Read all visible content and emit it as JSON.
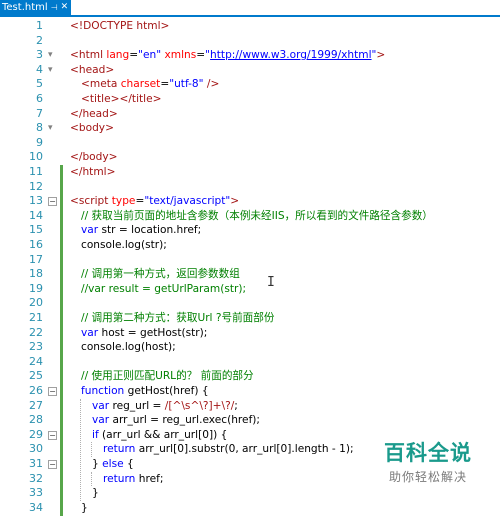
{
  "tab": {
    "title": "Test.html",
    "pin_glyph": "⊣",
    "close_glyph": "✕"
  },
  "watermark": {
    "title": "百科全说",
    "subtitle": "助你轻松解决"
  },
  "colors": {
    "keyword": "#0000ff",
    "tag": "#a31515",
    "attribute": "#ff0000",
    "comment": "#008000",
    "regex": "#a31515",
    "line_number": "#2b91af",
    "change_bar": "#57a64a",
    "tab": "#007acc"
  },
  "lines": [
    {
      "n": "1",
      "indent": 0,
      "tokens": [
        [
          "t",
          "<!DOCTYPE html>"
        ]
      ]
    },
    {
      "n": "2",
      "indent": 0,
      "tokens": []
    },
    {
      "n": "3",
      "indent": 0,
      "fold": "open",
      "tokens": [
        [
          "t",
          "<html "
        ],
        [
          "a",
          "lang"
        ],
        [
          "p",
          "="
        ],
        [
          "s",
          "\"en\""
        ],
        [
          "p",
          " "
        ],
        [
          "a",
          "xmlns"
        ],
        [
          "p",
          "="
        ],
        [
          "s",
          "\""
        ],
        [
          "u",
          "http://www.w3.org/1999/xhtml"
        ],
        [
          "s",
          "\""
        ],
        [
          "t",
          ">"
        ]
      ]
    },
    {
      "n": "4",
      "indent": 0,
      "fold": "open",
      "tokens": [
        [
          "t",
          "<head>"
        ]
      ]
    },
    {
      "n": "5",
      "indent": 1,
      "tokens": [
        [
          "t",
          "<meta "
        ],
        [
          "a",
          "charset"
        ],
        [
          "p",
          "="
        ],
        [
          "s",
          "\"utf-8\""
        ],
        [
          "t",
          " />"
        ]
      ]
    },
    {
      "n": "6",
      "indent": 1,
      "tokens": [
        [
          "t",
          "<title></title>"
        ]
      ]
    },
    {
      "n": "7",
      "indent": 0,
      "tokens": [
        [
          "t",
          "</head>"
        ]
      ]
    },
    {
      "n": "8",
      "indent": 0,
      "fold": "open",
      "tokens": [
        [
          "t",
          "<body>"
        ]
      ]
    },
    {
      "n": "9",
      "indent": 0,
      "tokens": []
    },
    {
      "n": "10",
      "indent": 0,
      "tokens": [
        [
          "t",
          "</body>"
        ]
      ]
    },
    {
      "n": "11",
      "indent": 0,
      "change": true,
      "tokens": [
        [
          "t",
          "</html>"
        ]
      ]
    },
    {
      "n": "12",
      "indent": 0,
      "change": true,
      "tokens": []
    },
    {
      "n": "13",
      "indent": 0,
      "change": true,
      "fold": "box",
      "tokens": [
        [
          "t",
          "<script "
        ],
        [
          "a",
          "type"
        ],
        [
          "p",
          "="
        ],
        [
          "s",
          "\"text/javascript\""
        ],
        [
          "t",
          ">"
        ]
      ]
    },
    {
      "n": "14",
      "indent": 1,
      "change": true,
      "tokens": [
        [
          "c",
          "// 获取当前页面的地址含参数（本例未经IIS，所以看到的文件路径含参数）"
        ]
      ]
    },
    {
      "n": "15",
      "indent": 1,
      "change": true,
      "tokens": [
        [
          "k",
          "var "
        ],
        [
          "p",
          "str = location.href;"
        ]
      ]
    },
    {
      "n": "16",
      "indent": 1,
      "change": true,
      "tokens": [
        [
          "p",
          "console.log(str);"
        ]
      ]
    },
    {
      "n": "17",
      "indent": 0,
      "change": true,
      "tokens": []
    },
    {
      "n": "18",
      "indent": 1,
      "change": true,
      "tokens": [
        [
          "c",
          "// 调用第一种方式，返回参数数组"
        ]
      ]
    },
    {
      "n": "19",
      "indent": 1,
      "change": true,
      "tokens": [
        [
          "c",
          "//var result = getUrlParam(str);"
        ]
      ]
    },
    {
      "n": "20",
      "indent": 0,
      "change": true,
      "tokens": []
    },
    {
      "n": "21",
      "indent": 1,
      "change": true,
      "tokens": [
        [
          "c",
          "// 调用第二种方式：获取Url ?号前面部份"
        ]
      ]
    },
    {
      "n": "22",
      "indent": 1,
      "change": true,
      "tokens": [
        [
          "k",
          "var "
        ],
        [
          "p",
          "host = getHost(str);"
        ]
      ]
    },
    {
      "n": "23",
      "indent": 1,
      "change": true,
      "tokens": [
        [
          "p",
          "console.log(host);"
        ]
      ]
    },
    {
      "n": "24",
      "indent": 0,
      "change": true,
      "tokens": []
    },
    {
      "n": "25",
      "indent": 1,
      "change": true,
      "tokens": [
        [
          "c",
          "// 使用正则匹配URL的？ 前面的部分"
        ]
      ]
    },
    {
      "n": "26",
      "indent": 1,
      "change": true,
      "fold": "box",
      "tokens": [
        [
          "k",
          "function "
        ],
        [
          "p",
          "getHost(href) {"
        ]
      ]
    },
    {
      "n": "27",
      "indent": 2,
      "change": true,
      "tokens": [
        [
          "k",
          "var "
        ],
        [
          "p",
          "reg_url = "
        ],
        [
          "r",
          "/[^\\s^\\?]+\\?/"
        ],
        [
          "p",
          ";"
        ]
      ]
    },
    {
      "n": "28",
      "indent": 2,
      "change": true,
      "tokens": [
        [
          "k",
          "var "
        ],
        [
          "p",
          "arr_url = reg_url.exec(href);"
        ]
      ]
    },
    {
      "n": "29",
      "indent": 2,
      "change": true,
      "fold": "box",
      "tokens": [
        [
          "k",
          "if "
        ],
        [
          "p",
          "(arr_url && arr_url[0]) {"
        ]
      ]
    },
    {
      "n": "30",
      "indent": 3,
      "change": true,
      "tokens": [
        [
          "k",
          "return "
        ],
        [
          "p",
          "arr_url[0].substr(0, arr_url[0].length - 1);"
        ]
      ]
    },
    {
      "n": "31",
      "indent": 2,
      "change": true,
      "fold": "box",
      "tokens": [
        [
          "p",
          "} "
        ],
        [
          "k",
          "else "
        ],
        [
          "p",
          "{"
        ]
      ]
    },
    {
      "n": "32",
      "indent": 3,
      "change": true,
      "tokens": [
        [
          "k",
          "return "
        ],
        [
          "p",
          "href;"
        ]
      ]
    },
    {
      "n": "33",
      "indent": 2,
      "change": true,
      "tokens": [
        [
          "p",
          "}"
        ]
      ]
    },
    {
      "n": "34",
      "indent": 1,
      "change": true,
      "tokens": [
        [
          "p",
          "}"
        ]
      ]
    }
  ]
}
